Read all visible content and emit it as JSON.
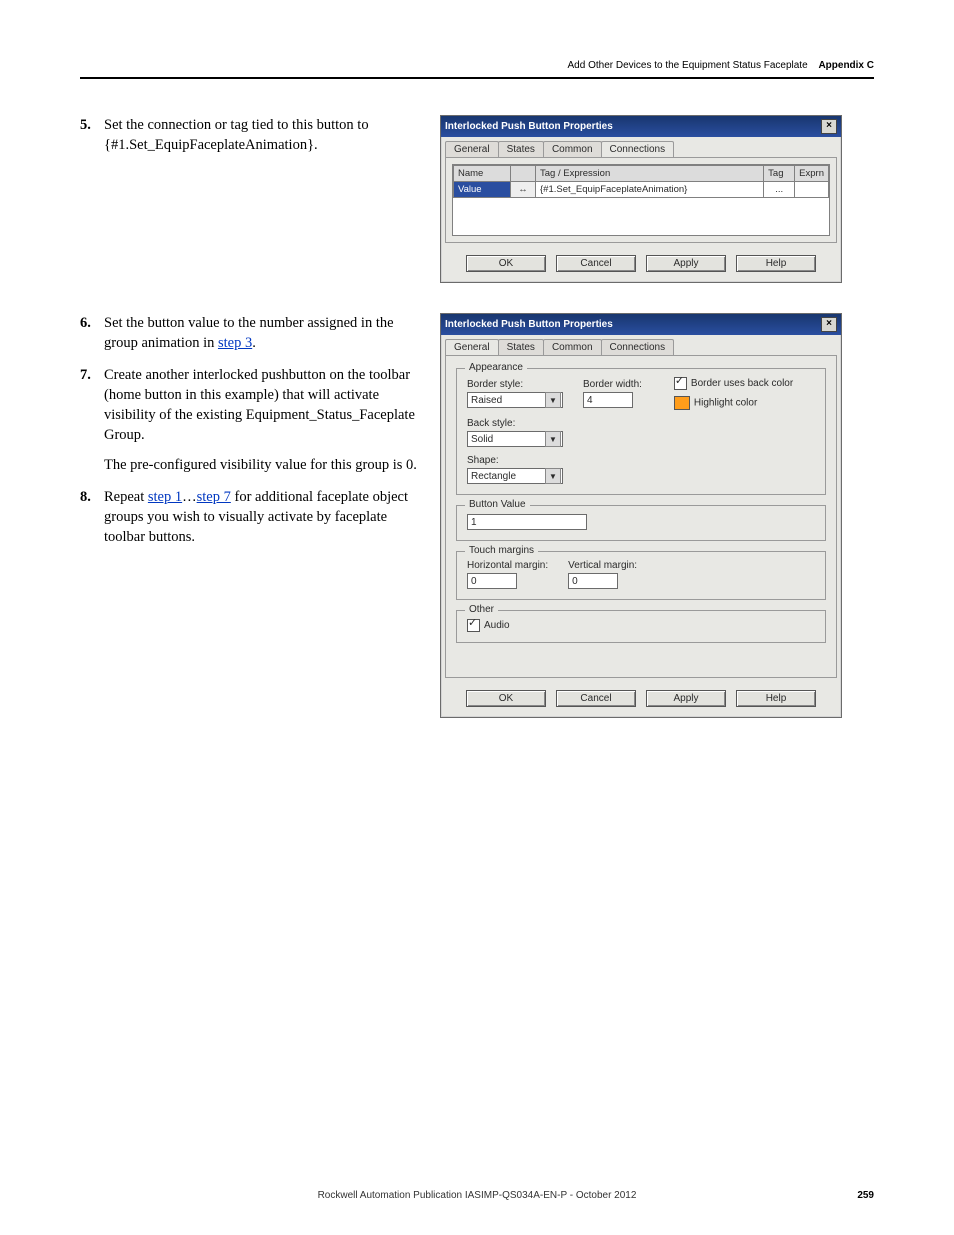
{
  "header": {
    "title": "Add Other Devices to the Equipment Status Faceplate",
    "appendix": "Appendix C"
  },
  "steps": {
    "s5": {
      "num": "5",
      "text": "Set the connection or tag tied to this button to {#1.Set_EquipFaceplateAnimation}."
    },
    "s6": {
      "num": "6",
      "text_a": "Set the button value to the number assigned in the group animation in ",
      "link": "step 3",
      "text_b": "."
    },
    "s7": {
      "num": "7",
      "text": "Create another interlocked pushbutton on the toolbar (home button in this example) that will activate visibility of the existing Equipment_Status_Faceplate Group.",
      "para": "The pre-configured visibility value for this group is 0."
    },
    "s8": {
      "num": "8",
      "text_a": "Repeat ",
      "link1": "step 1",
      "dots": "…",
      "link2": "step 7",
      "text_b": " for additional faceplate object groups you wish to visually activate by faceplate toolbar buttons."
    }
  },
  "dlg1": {
    "title": "Interlocked Push Button Properties",
    "tabs": {
      "t1": "General",
      "t2": "States",
      "t3": "Common",
      "t4": "Connections"
    },
    "gridhead": {
      "c1": "Name",
      "c2": "Tag / Expression",
      "c3": "Tag",
      "c4": "Exprn"
    },
    "row": {
      "name": "Value",
      "arrow": "↔",
      "expr": "{#1.Set_EquipFaceplateAnimation}",
      "tagbtn": "..."
    },
    "buttons": {
      "ok": "OK",
      "cancel": "Cancel",
      "apply": "Apply",
      "help": "Help"
    }
  },
  "dlg2": {
    "title": "Interlocked Push Button Properties",
    "tabs": {
      "t1": "General",
      "t2": "States",
      "t3": "Common",
      "t4": "Connections"
    },
    "appearance": {
      "legend": "Appearance",
      "border_style_lbl": "Border style:",
      "border_style_val": "Raised",
      "border_width_lbl": "Border width:",
      "border_width_val": "4",
      "border_uses_back": "Border uses back color",
      "highlight_lbl": "Highlight color",
      "back_style_lbl": "Back style:",
      "back_style_val": "Solid",
      "shape_lbl": "Shape:",
      "shape_val": "Rectangle"
    },
    "button_value": {
      "legend": "Button Value",
      "val": "1"
    },
    "touch": {
      "legend": "Touch margins",
      "h_lbl": "Horizontal margin:",
      "h_val": "0",
      "v_lbl": "Vertical margin:",
      "v_val": "0"
    },
    "other": {
      "legend": "Other",
      "audio": "Audio"
    },
    "buttons": {
      "ok": "OK",
      "cancel": "Cancel",
      "apply": "Apply",
      "help": "Help"
    }
  },
  "footer": {
    "pub": "Rockwell Automation Publication IASIMP-QS034A-EN-P - ",
    "date": "October 2012",
    "page": "259"
  }
}
